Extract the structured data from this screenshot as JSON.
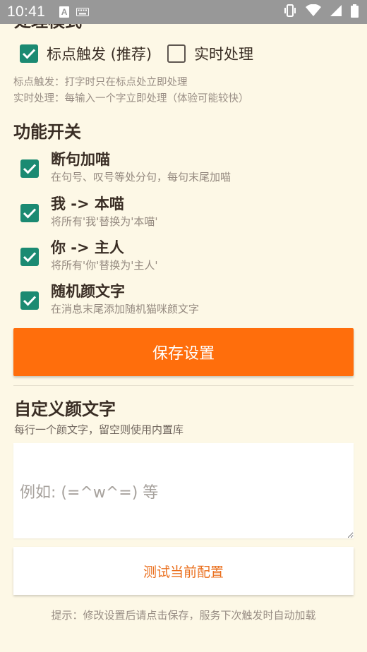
{
  "status_bar": {
    "time": "10:41",
    "notif_letter": "A",
    "icons": [
      "a-notification-icon",
      "keyboard-icon",
      "vibrate-icon",
      "wifi-icon",
      "signal-icon",
      "battery-icon"
    ]
  },
  "mode_section": {
    "title_partial": "处理模式",
    "options": [
      {
        "label": "标点触发 (推荐)",
        "checked": true
      },
      {
        "label": "实时处理",
        "checked": false
      }
    ],
    "descriptions": [
      "标点触发：打字时只在标点处立即处理",
      "实时处理：每输入一个字立即处理（体验可能较快）"
    ]
  },
  "features": {
    "title": "功能开关",
    "items": [
      {
        "title": "断句加喵",
        "desc": "在句号、叹号等处分句，每句末尾加喵",
        "checked": true
      },
      {
        "title": "我 -> 本喵",
        "desc": "将所有'我'替换为'本喵'",
        "checked": true
      },
      {
        "title": "你 -> 主人",
        "desc": "将所有'你'替换为'主人'",
        "checked": true
      },
      {
        "title": "随机颜文字",
        "desc": "在消息末尾添加随机猫咪颜文字",
        "checked": true
      }
    ]
  },
  "save_button": {
    "label": "保存设置"
  },
  "custom_kaomoji": {
    "title": "自定义颜文字",
    "desc": "每行一个颜文字，留空则使用内置库",
    "value": "",
    "placeholder": "例如: (=^w^=) 等"
  },
  "test_button": {
    "label": "测试当前配置"
  },
  "hint": "提示：修改设置后请点击保存，服务下次触发时自动加载",
  "colors": {
    "background": "#fdf8e6",
    "accent_orange": "#ff6e0c",
    "checkbox_teal": "#1b8a72",
    "status_bar": "#989898"
  }
}
